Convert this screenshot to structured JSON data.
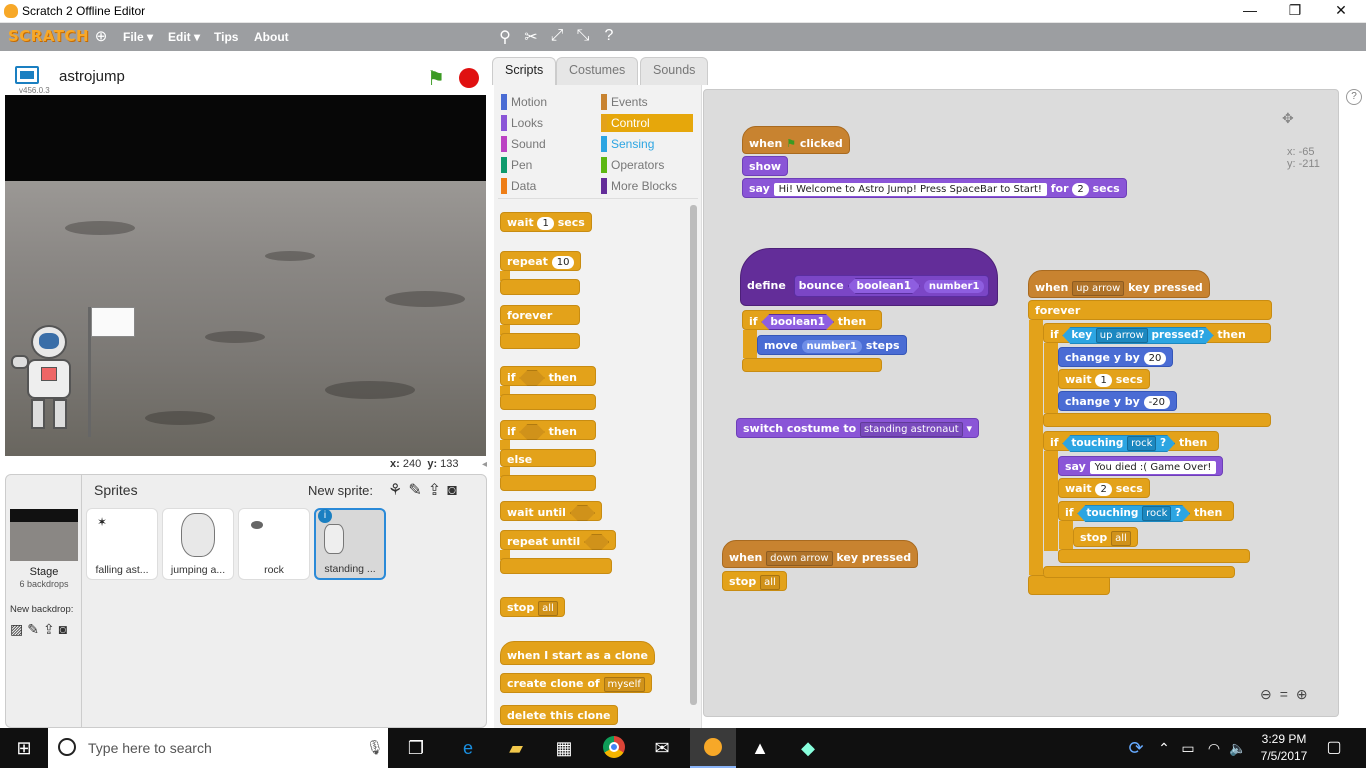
{
  "window": {
    "title": "Scratch 2 Offline Editor"
  },
  "menu": {
    "logo": "SCRATCH",
    "file": "File ▾",
    "edit": "Edit ▾",
    "tips": "Tips",
    "about": "About"
  },
  "stage": {
    "project_name": "astrojump",
    "version": "v456.0.3",
    "x_label": "x:",
    "x_value": "240",
    "y_label": "y:",
    "y_value": "133"
  },
  "sprites": {
    "header": "Sprites",
    "new_sprite": "New sprite:",
    "stage_label": "Stage",
    "backdrops": "6 backdrops",
    "new_backdrop": "New backdrop:",
    "items": [
      "falling ast...",
      "jumping a...",
      "rock",
      "standing ..."
    ]
  },
  "tabs": {
    "scripts": "Scripts",
    "costumes": "Costumes",
    "sounds": "Sounds"
  },
  "categories": {
    "motion": "Motion",
    "looks": "Looks",
    "sound": "Sound",
    "pen": "Pen",
    "data": "Data",
    "events": "Events",
    "control": "Control",
    "sensing": "Sensing",
    "operators": "Operators",
    "more": "More Blocks"
  },
  "palette": {
    "wait": "wait",
    "wait_val": "1",
    "secs": "secs",
    "repeat": "repeat",
    "repeat_val": "10",
    "forever": "forever",
    "if": "if",
    "then": "then",
    "else": "else",
    "wait_until": "wait until",
    "repeat_until": "repeat until",
    "stop": "stop",
    "stop_val": "all",
    "when_clone": "when I start as a clone",
    "create_clone": "create clone of",
    "create_clone_val": "myself",
    "delete_clone": "delete this clone"
  },
  "script1": {
    "when": "when",
    "clicked": "clicked",
    "show": "show",
    "say": "say",
    "say_text": "Hi! Welcome to Astro Jump! Press SpaceBar to Start!",
    "for": "for",
    "secs_val": "2",
    "secs": "secs"
  },
  "define": {
    "define": "define",
    "bounce": "bounce",
    "arg1": "boolean1",
    "arg2": "number1",
    "if": "if",
    "then": "then",
    "move": "move",
    "steps": "steps"
  },
  "switch": {
    "label": "switch costume to",
    "value": "standing astronaut"
  },
  "script_down": {
    "when": "when",
    "key": "down arrow",
    "pressed": "key pressed",
    "stop": "stop",
    "stop_val": "all"
  },
  "script_up": {
    "when": "when",
    "key": "up arrow",
    "pressed": "key pressed",
    "forever": "forever",
    "if": "if",
    "key_label": "key",
    "key_val": "up arrow",
    "pressed_q": "pressed?",
    "then": "then",
    "change_y": "change y by",
    "change_up": "20",
    "wait": "wait",
    "wait1": "1",
    "secs": "secs",
    "change_down": "-20",
    "touching": "touching",
    "rock": "rock",
    "q": "?",
    "say": "say",
    "died": "You died :( Game Over!",
    "wait2": "2",
    "stop": "stop",
    "stop_val": "all"
  },
  "mouse": {
    "x": "x: -65",
    "y": "y: -211"
  },
  "taskbar": {
    "search": "Type here to search",
    "time": "3:29 PM",
    "date": "7/5/2017"
  }
}
